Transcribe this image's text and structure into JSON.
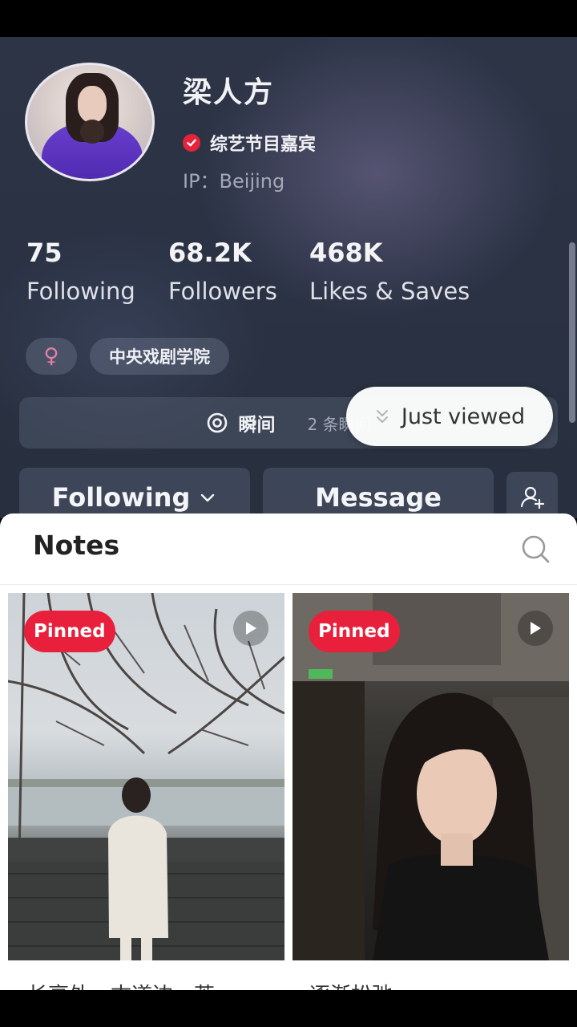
{
  "profile": {
    "name": "梁人方",
    "verified_label": "综艺节目嘉宾",
    "ip": "IP：Beijing"
  },
  "stats": [
    {
      "value": "75",
      "label": "Following"
    },
    {
      "value": "68.2K",
      "label": "Followers"
    },
    {
      "value": "468K",
      "label": "Likes & Saves"
    }
  ],
  "tags": {
    "gender_symbol": "♀",
    "school": "中央戏剧学院"
  },
  "moments": {
    "title": "瞬间",
    "count": "2 条瞬间"
  },
  "actions": {
    "following_label": "Following",
    "message_label": "Message"
  },
  "notes": {
    "title": "Notes",
    "cards": [
      {
        "badge": "Pinned",
        "caption": "长亭外，古道边，芳"
      },
      {
        "badge": "Pinned",
        "caption": "逐渐松弛"
      }
    ],
    "just_viewed": "Just viewed"
  },
  "colors": {
    "accent_red": "#e8203c",
    "verified_red": "#e5243b",
    "profile_bg": "#2c3446",
    "gender_pink": "#e37fa6"
  },
  "icons": [
    "check-icon",
    "female-icon",
    "moment-icon",
    "chevron-down-icon",
    "add-friend-icon",
    "search-icon",
    "play-icon",
    "double-chevron-down-icon"
  ]
}
